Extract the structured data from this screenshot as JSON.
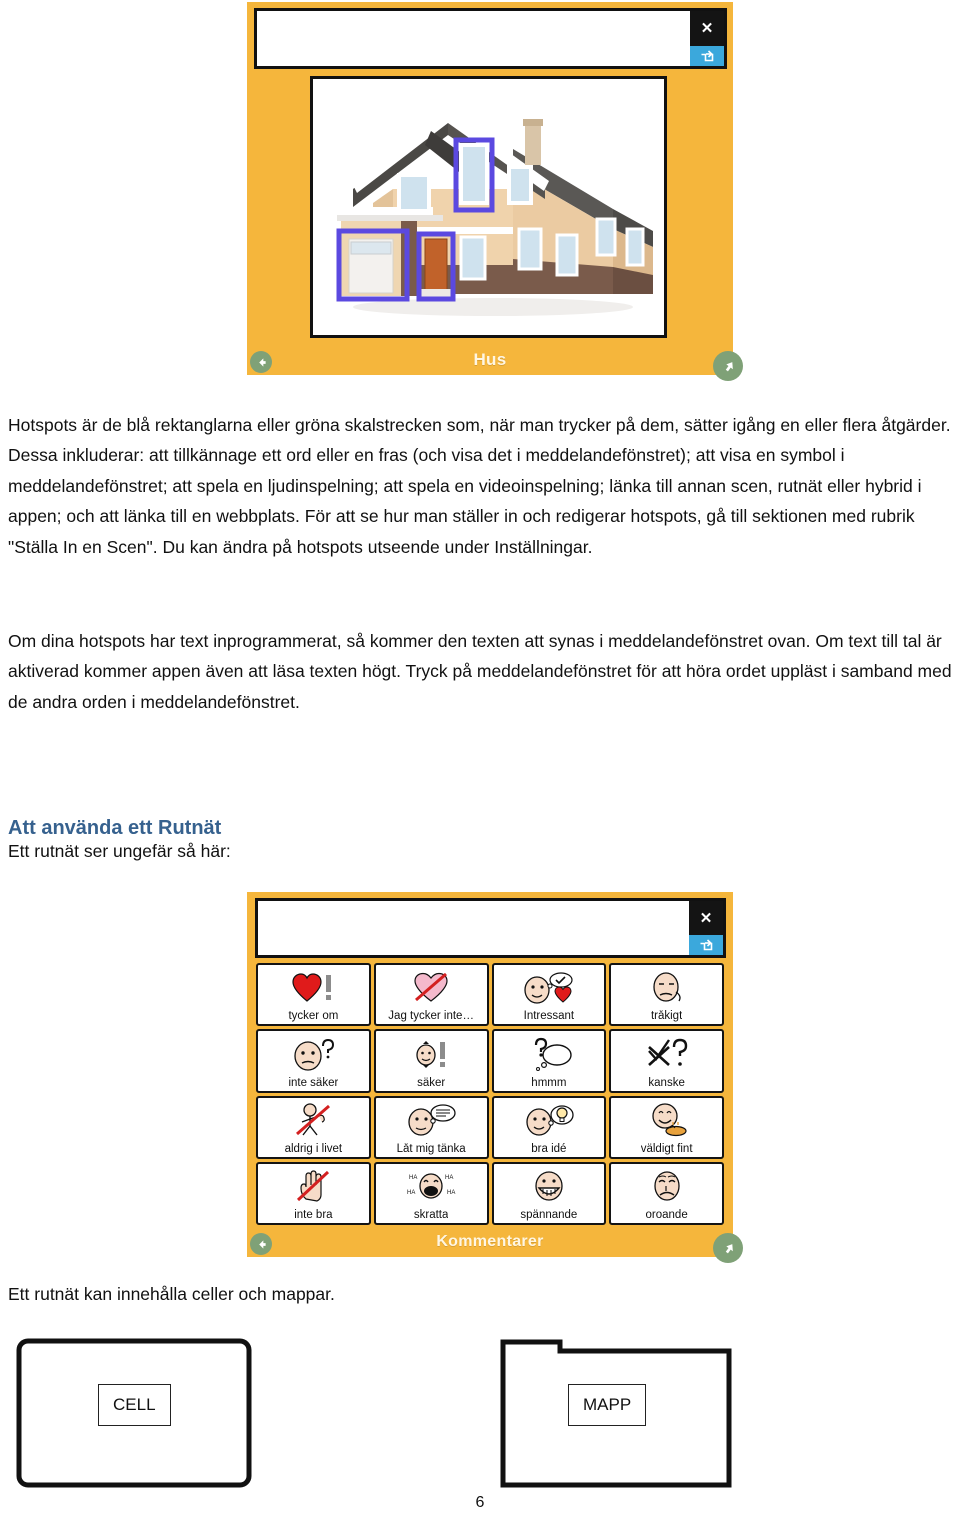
{
  "document": {
    "page_number": "6",
    "heading_color": "#36618E",
    "paragraphs": {
      "p1": "Hotspots är de blå rektanglarna eller gröna skalstrecken som, när man trycker på dem, sätter igång en eller flera åtgärder. Dessa inkluderar: att tillkännage ett ord eller en fras (och visa det i meddelandefönstret); att visa en symbol i meddelandefönstret; att spela en ljudinspelning; att spela en videoinspelning; länka till annan scen, rutnät eller hybrid i appen; och att länka till en webbplats. För att se hur man ställer in och redigerar hotspots, gå till sektionen med rubrik \"Ställa In en Scen\". Du kan ändra på hotspots utseende under Inställningar.",
      "p2": "Om dina hotspots har text inprogrammerat, så kommer den texten att synas i meddelandefönstret ovan. Om text till tal är aktiverad kommer appen även att läsa texten högt. Tryck på meddelandefönstret för att höra ordet uppläst i samband med de andra orden i meddelandefönstret."
    },
    "section_heading": "Att använda ett Rutnät",
    "line_rutnat": "Ett rutnät ser ungefär så här:",
    "line_cellmapp": "Ett rutnät kan innehålla celler och mappar.",
    "shapes": {
      "cell_label": "CELL",
      "mapp_label": "MAPP"
    }
  },
  "scene_screenshot": {
    "frame_color": "#F5B63C",
    "title": "Hus",
    "message_bar": {
      "value": "",
      "close_icon": "close-x-icon",
      "share_icon": "share-export-icon",
      "close_color": "#141414",
      "share_color": "#3BA8DC"
    },
    "nav": {
      "back_icon": "arrow-left-icon",
      "forward_icon": "arrow-pointer-icon",
      "button_color": "#7FA177"
    },
    "hotspot_color": "#5B49E0",
    "hotspots": [
      "upstairs-window",
      "garage-door",
      "front-door"
    ],
    "image_alt": "Hus"
  },
  "grid_screenshot": {
    "frame_color": "#F5B63C",
    "title": "Kommentarer",
    "message_bar": {
      "value": "",
      "close_icon": "close-x-icon",
      "share_icon": "share-export-icon",
      "close_color": "#141414",
      "share_color": "#3BA8DC"
    },
    "nav": {
      "back_icon": "arrow-left-icon",
      "forward_icon": "arrow-pointer-icon",
      "button_color": "#7FA177"
    },
    "columns": 4,
    "rows": 4,
    "cells": [
      {
        "label": "tycker om",
        "symbol": "heart-exclamation-icon"
      },
      {
        "label": "Jag tycker inte…",
        "symbol": "heart-crossed-icon"
      },
      {
        "label": "Intressant",
        "symbol": "face-thought-heart-icon"
      },
      {
        "label": "tråkigt",
        "symbol": "face-bored-icon"
      },
      {
        "label": "inte säker",
        "symbol": "face-question-icon"
      },
      {
        "label": "säker",
        "symbol": "face-exclamation-icon"
      },
      {
        "label": "hmmm",
        "symbol": "thought-bubble-question-icon"
      },
      {
        "label": "kanske",
        "symbol": "check-cross-question-icon"
      },
      {
        "label": "aldrig i livet",
        "symbol": "person-crossed-icon"
      },
      {
        "label": "Låt mig tänka",
        "symbol": "face-thinking-lines-icon"
      },
      {
        "label": "bra idé",
        "symbol": "face-lightbulb-icon"
      },
      {
        "label": "väldigt fint",
        "symbol": "face-smiling-dish-icon"
      },
      {
        "label": "inte bra",
        "symbol": "hand-ok-crossed-icon"
      },
      {
        "label": "skratta",
        "symbol": "face-laughing-haha-icon"
      },
      {
        "label": "spännande",
        "symbol": "face-grin-icon"
      },
      {
        "label": "oroande",
        "symbol": "face-worried-icon"
      }
    ]
  }
}
